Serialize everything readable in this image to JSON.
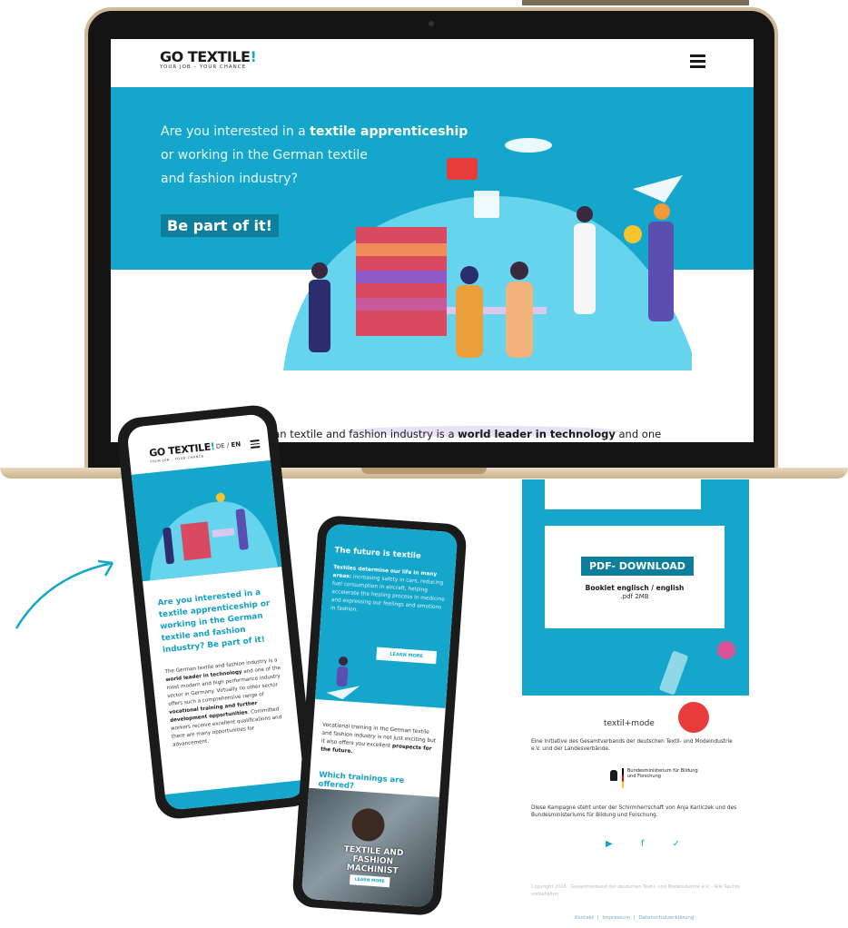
{
  "laptop": {
    "logo": "GO TEXTILE",
    "logo_bang": "!",
    "logo_tagline": "YOUR JOB – YOUR CHANCE",
    "hero": {
      "line1_prefix": "Are you interested in a ",
      "line1_bold": "textile apprenticeship",
      "line2": "or working in the German textile",
      "line3": "and fashion industry?",
      "cta": "Be part of it!"
    },
    "intro_prefix": "man textile and fashion industry is a ",
    "intro_bold": "world leader in technology",
    "intro_suffix": " and one"
  },
  "phone_left": {
    "logo": "GO TEXTILE",
    "logo_bang": "!",
    "logo_tagline": "YOUR JOB – YOUR CHANCE",
    "lang_de": "DE / ",
    "lang_en": "EN",
    "heading": "Are you interested in a textile apprenticeship or working in the German textile and fashion industry? Be part of it!",
    "body_1": "The German textile and fashion industry is a ",
    "body_b1": "world leader in technology",
    "body_2": " and one of the most modern and high performance industry sector in Germany. Virtually no other sector offers such a comprehensive range of ",
    "body_b2": "vocational training and further development opportunities",
    "body_3": ". Committed workers receive excellent qualifications and there are many opportunities for advancement."
  },
  "phone_middle": {
    "title": "The future is textile",
    "text_b": "Textiles determine our life in many areas:",
    "text": " increasing safety in cars, reducing fuel consumption in aircraft, helping accelerate the healing process in medicine and expressing our feelings and emotions in fashion.",
    "learn_more": "LEARN MORE",
    "voc_1": "Vocational training in the German textile and fashion industry is not just exciting but it also offers you excellent ",
    "voc_b": "prospects for the future.",
    "which": "Which trainings are offered?",
    "photo_title": "TEXTILE AND FASHION MACHINIST",
    "photo_learn": "LEARN MORE"
  },
  "phone_right": {
    "pdf_button": "PDF- DOWNLOAD",
    "booklet": "Booklet englisch / english",
    "booklet_size": ".pdf 2MB",
    "brand": "textil+mode",
    "initiative": "Eine Initiative des Gesamtverbands der deutschen Textil- und Modeindustrie e.V. und der Landesverbände.",
    "ministry": "Bundesministerium für Bildung und Forschung",
    "patronage": "Diese Kampagne steht unter der Schirmherrschaft von Anja Karliczek und des Bundesministeriums für Bildung und Forschung.",
    "social": "▶ f ✓",
    "copyright": "Copyright 2016 - Gesamtverband der deutschen Textil- und Modeindustrie e.V. - Alle Rechte vorbehalten",
    "footer_links": "Kontakt  |  Impressum  |  Datenschutzerklärung"
  },
  "colors": {
    "brand_blue": "#15a7cb",
    "dark_blue": "#0d7f9c",
    "accent_red": "#e83b3b"
  }
}
